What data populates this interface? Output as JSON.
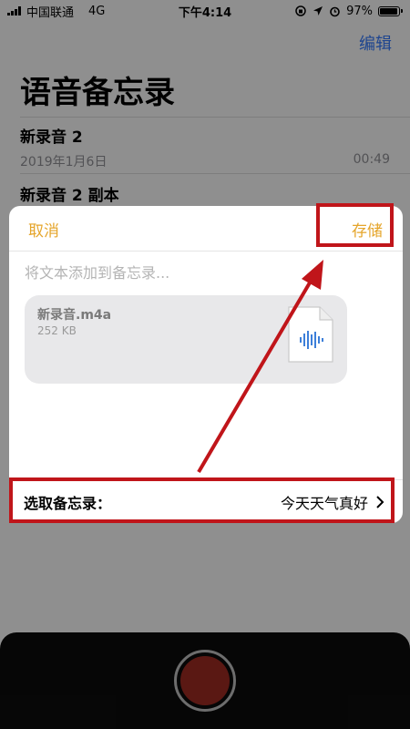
{
  "status_bar": {
    "carrier": "中国联通",
    "network": "4G",
    "time": "下午4:14",
    "battery": "97%",
    "battery_level": 0.97
  },
  "header": {
    "edit_label": "编辑",
    "title": "语音备忘录"
  },
  "recordings": [
    {
      "name": "新录音 2",
      "date": "2019年1月6日",
      "duration": "00:49"
    },
    {
      "name": "新录音 2 副本"
    }
  ],
  "sheet": {
    "cancel_label": "取消",
    "save_label": "存储",
    "input_placeholder": "将文本添加到备忘录...",
    "attachment": {
      "file_name": "新录音.m4a",
      "file_size": "252 KB",
      "icon": "audio-file-icon"
    },
    "footer": {
      "label": "选取备忘录：",
      "value": "今天天气真好"
    }
  },
  "colors": {
    "accent": "#e5a52b",
    "edit_blue": "#3478f6",
    "annotation": "#c0151a",
    "record_button": "#9c2a22"
  }
}
